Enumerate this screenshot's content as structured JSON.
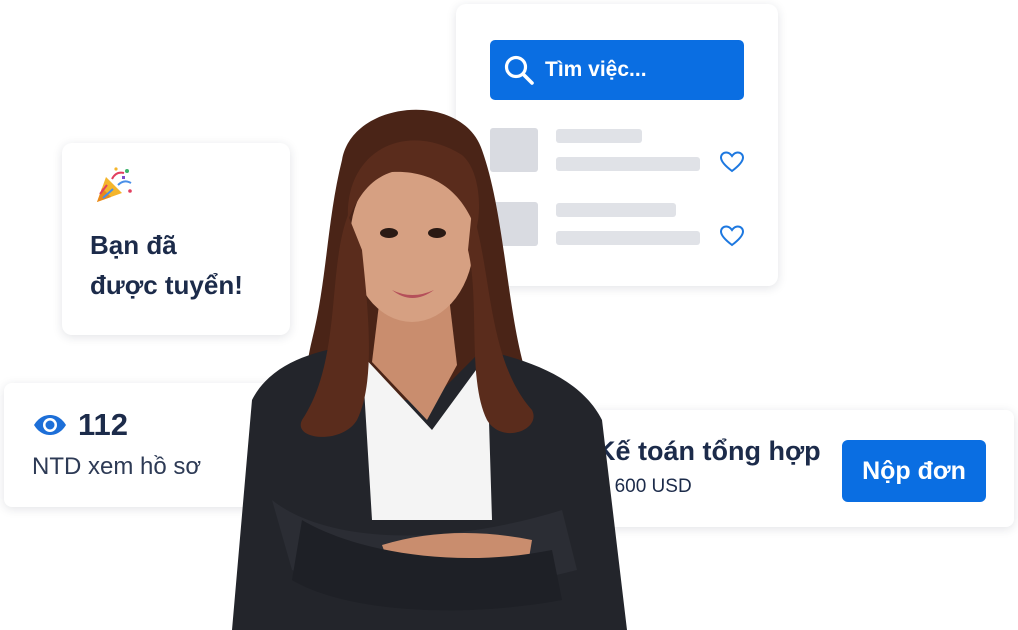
{
  "search_card": {
    "placeholder": "Tìm việc...",
    "icon": "search-icon",
    "accent": "#0a6ee2",
    "rows": [
      {
        "icon": "heart-icon"
      },
      {
        "icon": "heart-icon"
      }
    ]
  },
  "hired_card": {
    "emoji": "party-popper-icon",
    "line1": "Bạn đã",
    "line2": "được tuyển!"
  },
  "views_card": {
    "icon": "eye-icon",
    "count": "112",
    "label": "NTD xem hồ sơ"
  },
  "job_card": {
    "title": "Kế toán tổng hợp",
    "currency_symbol": "$",
    "salary": "600 USD",
    "apply_label": "Nộp đơn"
  }
}
